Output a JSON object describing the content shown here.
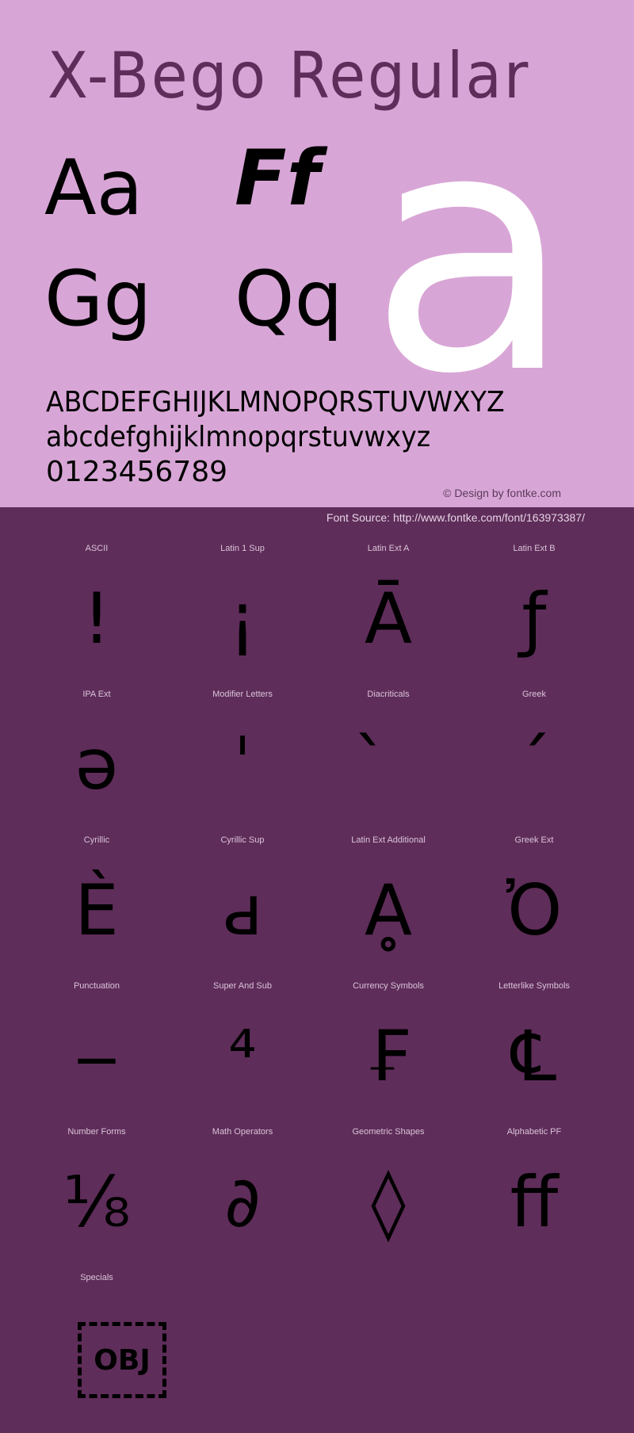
{
  "header": {
    "title": "X-Bego Regular"
  },
  "preview": {
    "pairs": [
      "Aa",
      "Ff",
      "Gg",
      "Qq"
    ],
    "big_glyph": "a",
    "uppercase": "ABCDEFGHIJKLMNOPQRSTUVWXYZ",
    "lowercase": "abcdefghijklmnopqrstuvwxyz",
    "digits": "0123456789",
    "credit": "© Design by fontke.com"
  },
  "source": {
    "text": "Font Source: http://www.fontke.com/font/163973387/"
  },
  "colors": {
    "top_background": "#d8a6d6",
    "bottom_background": "#5f2d5a",
    "title_color": "#5f2d5a",
    "glyph_color": "#000000",
    "big_glyph_color": "#ffffff"
  },
  "blocks": [
    {
      "label": "ASCII",
      "glyph": "!"
    },
    {
      "label": "Latin 1 Sup",
      "glyph": "¡"
    },
    {
      "label": "Latin Ext A",
      "glyph": "Ā"
    },
    {
      "label": "Latin Ext B",
      "glyph": "ƒ"
    },
    {
      "label": "IPA Ext",
      "glyph": "ə"
    },
    {
      "label": "Modifier Letters",
      "glyph": "ˈ"
    },
    {
      "label": "Diacriticals",
      "glyph": "̀"
    },
    {
      "label": "Greek",
      "glyph": "΄"
    },
    {
      "label": "Cyrillic",
      "glyph": "Ѐ"
    },
    {
      "label": "Cyrillic Sup",
      "glyph": "ԁ"
    },
    {
      "label": "Latin Ext Additional",
      "glyph": "Ḁ"
    },
    {
      "label": "Greek Ext",
      "glyph": "Ὀ"
    },
    {
      "label": "Punctuation",
      "glyph": "‒"
    },
    {
      "label": "Super And Sub",
      "glyph": "⁴"
    },
    {
      "label": "Currency Symbols",
      "glyph": "₣"
    },
    {
      "label": "Letterlike Symbols",
      "glyph": "℄"
    },
    {
      "label": "Number Forms",
      "glyph": "⅛"
    },
    {
      "label": "Math Operators",
      "glyph": "∂"
    },
    {
      "label": "Geometric Shapes",
      "glyph": "◊"
    },
    {
      "label": "Alphabetic PF",
      "glyph": "ﬀ"
    },
    {
      "label": "Specials",
      "glyph": "OBJ"
    }
  ]
}
